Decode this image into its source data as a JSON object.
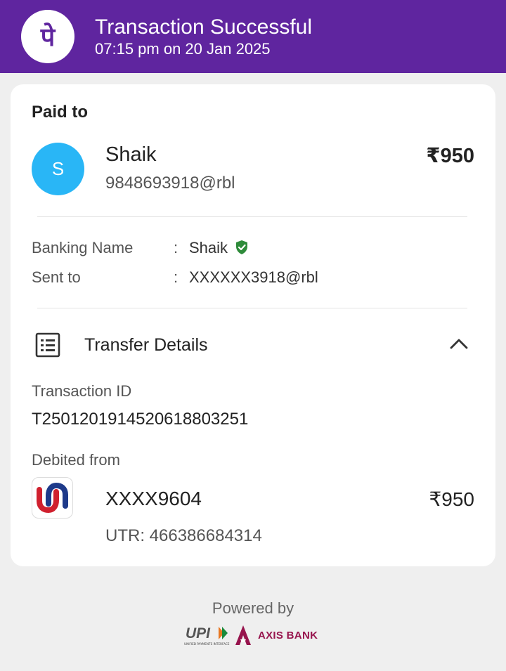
{
  "header": {
    "title": "Transaction Successful",
    "datetime": "07:15 pm on 20 Jan 2025",
    "logo_glyph": "पे",
    "bg_color": "#5f259f"
  },
  "payee": {
    "section_label": "Paid to",
    "avatar_initial": "S",
    "avatar_color": "#29b6f6",
    "name": "Shaik",
    "upi_id": "9848693918@rbl",
    "amount": "₹950"
  },
  "details": {
    "banking_name_label": "Banking Name",
    "banking_name_value": "Shaik",
    "sent_to_label": "Sent to",
    "sent_to_value": "XXXXXX3918@rbl",
    "separator": ":"
  },
  "transfer": {
    "section_title": "Transfer Details",
    "transaction_id_label": "Transaction ID",
    "transaction_id": "T2501201914520618803251",
    "debited_from_label": "Debited from",
    "account": "XXXX9604",
    "amount": "₹950",
    "utr": "UTR: 466386684314"
  },
  "footer": {
    "powered_by": "Powered by",
    "upi_text": "UPI",
    "upi_subtext": "UNIFIED PAYMENTS INTERFACE",
    "bank_name": "AXIS BANK"
  },
  "icons": {
    "logo": "phonepe-logo-icon",
    "verified": "verified-shield-icon",
    "doc": "document-list-icon",
    "chevron": "chevron-up-icon",
    "bank": "union-bank-logo-icon"
  }
}
